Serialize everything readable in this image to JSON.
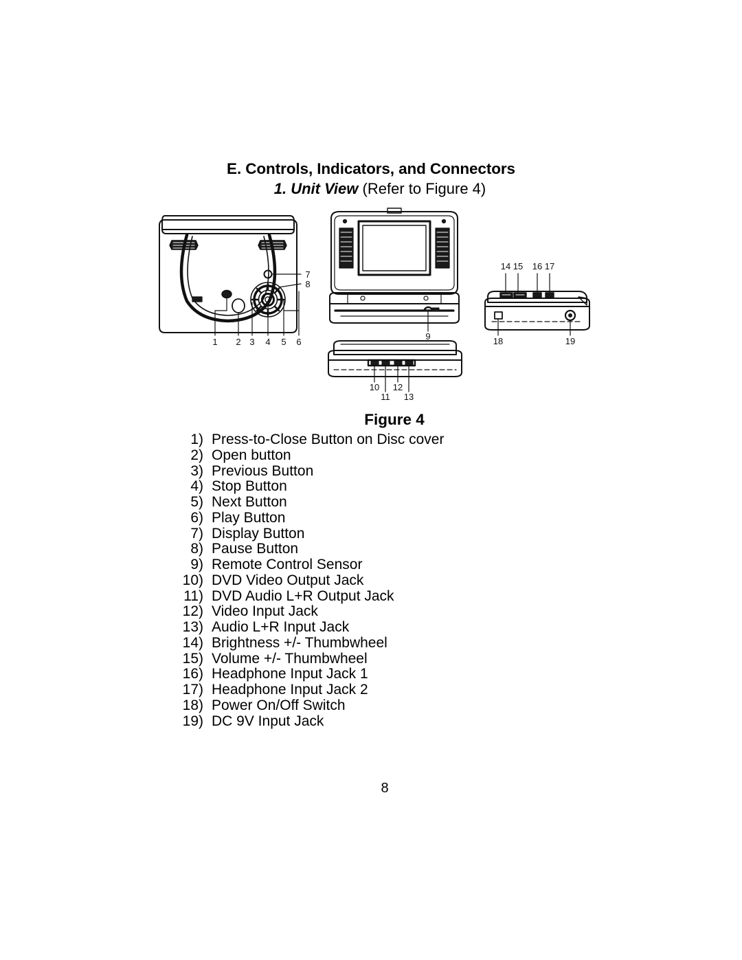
{
  "document": {
    "section_title": "E. Controls, Indicators, and Connectors",
    "subsection_label": "1. Unit View",
    "subsection_note": "(Refer to Figure 4)",
    "figure_caption": "Figure 4",
    "page_number": "8"
  },
  "figure": {
    "name": "figure-4-unit-views",
    "views": [
      {
        "name": "top-view-closed-disc-cover",
        "description": "Top view of portable DVD player showing disc cover, speaker grilles and control buttons",
        "callouts": [
          "1",
          "2",
          "3",
          "4",
          "5",
          "6",
          "7",
          "8"
        ]
      },
      {
        "name": "front-view-open-lcd",
        "description": "Front view of unit opened showing LCD screen and side speakers",
        "callouts": [
          "9"
        ]
      },
      {
        "name": "front-edge-view-jacks",
        "description": "Front edge view showing audio and video input/output jacks",
        "callouts": [
          "10",
          "11",
          "12",
          "13"
        ]
      },
      {
        "name": "right-side-view-controls",
        "description": "Right side view showing thumbwheels, headphone jacks, power switch and DC input",
        "callouts": [
          "14",
          "15",
          "16",
          "17",
          "18",
          "19"
        ]
      }
    ]
  },
  "legend": {
    "items": [
      {
        "num": "1)",
        "label": "Press-to-Close Button on Disc cover"
      },
      {
        "num": "2)",
        "label": "Open button"
      },
      {
        "num": "3)",
        "label": "Previous Button"
      },
      {
        "num": "4)",
        "label": "Stop Button"
      },
      {
        "num": "5)",
        "label": "Next Button"
      },
      {
        "num": "6)",
        "label": "Play Button"
      },
      {
        "num": "7)",
        "label": "Display Button"
      },
      {
        "num": "8)",
        "label": "Pause Button"
      },
      {
        "num": "9)",
        "label": "Remote Control Sensor"
      },
      {
        "num": "10)",
        "label": "DVD  Video Output Jack"
      },
      {
        "num": "11)",
        "label": " DVD Audio L+R Output Jack"
      },
      {
        "num": "12)",
        "label": " Video Input Jack"
      },
      {
        "num": "13)",
        "label": " Audio L+R  Input Jack"
      },
      {
        "num": "14)",
        "label": " Brightness +/-  Thumbwheel"
      },
      {
        "num": "15)",
        "label": " Volume +/-  Thumbwheel"
      },
      {
        "num": "16)",
        "label": " Headphone Input Jack  1"
      },
      {
        "num": "17)",
        "label": " Headphone Input Jack  2"
      },
      {
        "num": "18)",
        "label": " Power On/Off  Switch"
      },
      {
        "num": "19)",
        "label": " DC 9V  Input Jack"
      }
    ]
  },
  "colors": {
    "ink": "#000000",
    "paper": "#ffffff"
  }
}
